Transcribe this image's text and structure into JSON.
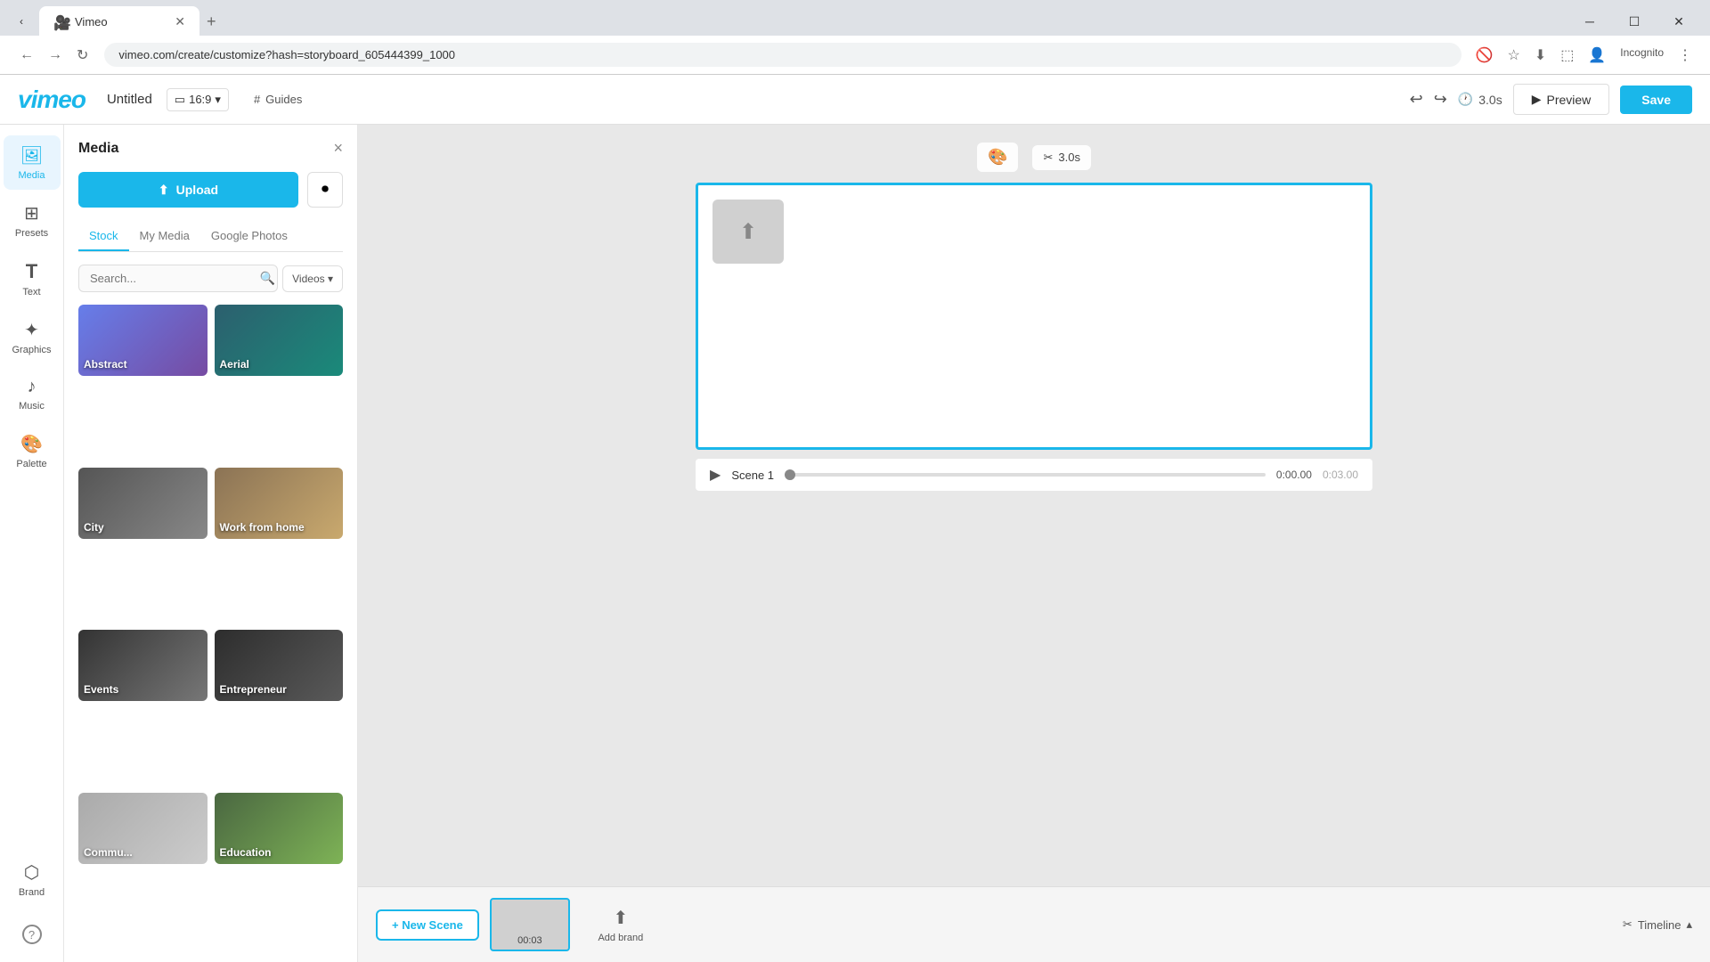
{
  "browser": {
    "tab_title": "Vimeo",
    "url": "vimeo.com/create/customize?hash=storyboard_605444399_1000",
    "favicon": "🎥"
  },
  "toolbar": {
    "logo": "vimeo",
    "title": "Untitled",
    "ratio": "16:9",
    "guides_label": "Guides",
    "duration": "3.0s",
    "preview_label": "Preview",
    "save_label": "Save"
  },
  "sidebar": {
    "items": [
      {
        "id": "media",
        "label": "Media",
        "icon": "🖼",
        "active": true
      },
      {
        "id": "presets",
        "label": "Presets",
        "icon": "⊞",
        "active": false
      },
      {
        "id": "text",
        "label": "Text",
        "icon": "T",
        "active": false
      },
      {
        "id": "graphics",
        "label": "Graphics",
        "icon": "✦",
        "active": false
      },
      {
        "id": "music",
        "label": "Music",
        "icon": "♪",
        "active": false
      },
      {
        "id": "palette",
        "label": "Palette",
        "icon": "🎨",
        "active": false
      },
      {
        "id": "brand",
        "label": "Brand",
        "icon": "⬡",
        "active": false
      }
    ]
  },
  "media_panel": {
    "title": "Media",
    "upload_label": "Upload",
    "tabs": [
      "Stock",
      "My Media",
      "Google Photos"
    ],
    "active_tab": "Stock",
    "search_placeholder": "Search...",
    "filter_label": "Videos",
    "cards": [
      {
        "id": "abstract",
        "label": "Abstract",
        "theme": "abstract"
      },
      {
        "id": "aerial",
        "label": "Aerial",
        "theme": "aerial"
      },
      {
        "id": "city",
        "label": "City",
        "theme": "city"
      },
      {
        "id": "work",
        "label": "Work from home",
        "theme": "work"
      },
      {
        "id": "events",
        "label": "Events",
        "theme": "events"
      },
      {
        "id": "entrepreneur",
        "label": "Entrepreneur",
        "theme": "entrepreneur"
      },
      {
        "id": "community",
        "label": "Commu...",
        "theme": "community"
      },
      {
        "id": "education",
        "label": "Education",
        "theme": "education"
      }
    ]
  },
  "canvas": {
    "duration": "3.0s",
    "scene_label": "Scene 1",
    "time_current": "0:00.00",
    "time_total": "0:03.00"
  },
  "timeline": {
    "toggle_label": "Timeline",
    "new_scene_label": "+ New Scene",
    "scene_time": "00:03",
    "add_brand_label": "Add brand"
  },
  "icons": {
    "scissors": "✂",
    "upload": "⬆",
    "record": "⏺",
    "play": "▶",
    "undo": "↩",
    "redo": "↪",
    "clock": "🕐",
    "preview_play": "▶",
    "aspect": "▭",
    "grid": "#",
    "close": "×",
    "add": "+",
    "chevron_down": "▾",
    "chevron_up": "▴",
    "search": "🔍",
    "brand_icon": "⬡",
    "placeholder_icon": "⬆"
  }
}
